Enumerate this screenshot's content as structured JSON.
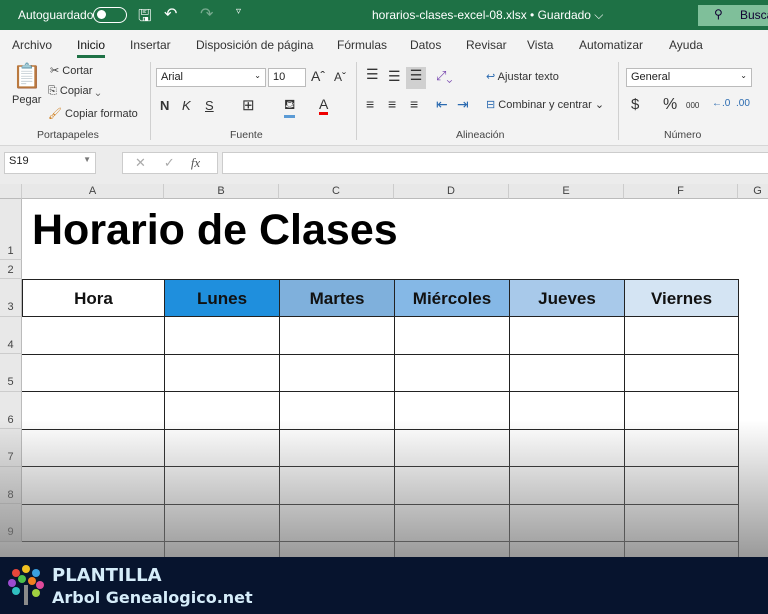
{
  "titlebar": {
    "autosave": "Autoguardado",
    "autosave_on": false,
    "filename": "horarios-clases-excel-08.xlsx • Guardado ⌵",
    "search": "Buscar",
    "color": "#1e7145"
  },
  "menu": [
    "Archivo",
    "Inicio",
    "Insertar",
    "Disposición de página",
    "Fórmulas",
    "Datos",
    "Revisar",
    "Vista",
    "Automatizar",
    "Ayuda"
  ],
  "ribbon": {
    "clipboard": {
      "paste": "Pegar",
      "cut": "Cortar",
      "copy": "Copiar",
      "format_painter": "Copiar formato",
      "group": "Portapapeles"
    },
    "font": {
      "name": "Arial",
      "size": "10",
      "bold": "N",
      "italic": "K",
      "underline": "S",
      "group": "Fuente"
    },
    "alignment": {
      "wrap": "Ajustar texto",
      "merge": "Combinar y centrar",
      "group": "Alineación"
    },
    "number": {
      "format": "General",
      "currency": "$",
      "percent": "%",
      "thousands": "000",
      "group": "Número"
    }
  },
  "formula_bar": {
    "name_box": "S19",
    "value": "",
    "fx": "fx"
  },
  "columns": [
    "A",
    "B",
    "C",
    "D",
    "E",
    "F",
    "G"
  ],
  "rows": [
    "1",
    "2",
    "3",
    "4",
    "5",
    "6",
    "7",
    "8",
    "9"
  ],
  "sheet": {
    "title": "Horario de Clases",
    "headers": [
      {
        "label": "Hora",
        "color": "#ffffff"
      },
      {
        "label": "Lunes",
        "color": "#1f8fdd"
      },
      {
        "label": "Martes",
        "color": "#7fb0dc"
      },
      {
        "label": "Miércoles",
        "color": "#85b8e6"
      },
      {
        "label": "Jueves",
        "color": "#a8c9ea"
      },
      {
        "label": "Viernes",
        "color": "#d4e4f3"
      }
    ]
  },
  "banner": {
    "line1": "PLANTILLA",
    "line2": "Arbol Genealogico.net"
  }
}
